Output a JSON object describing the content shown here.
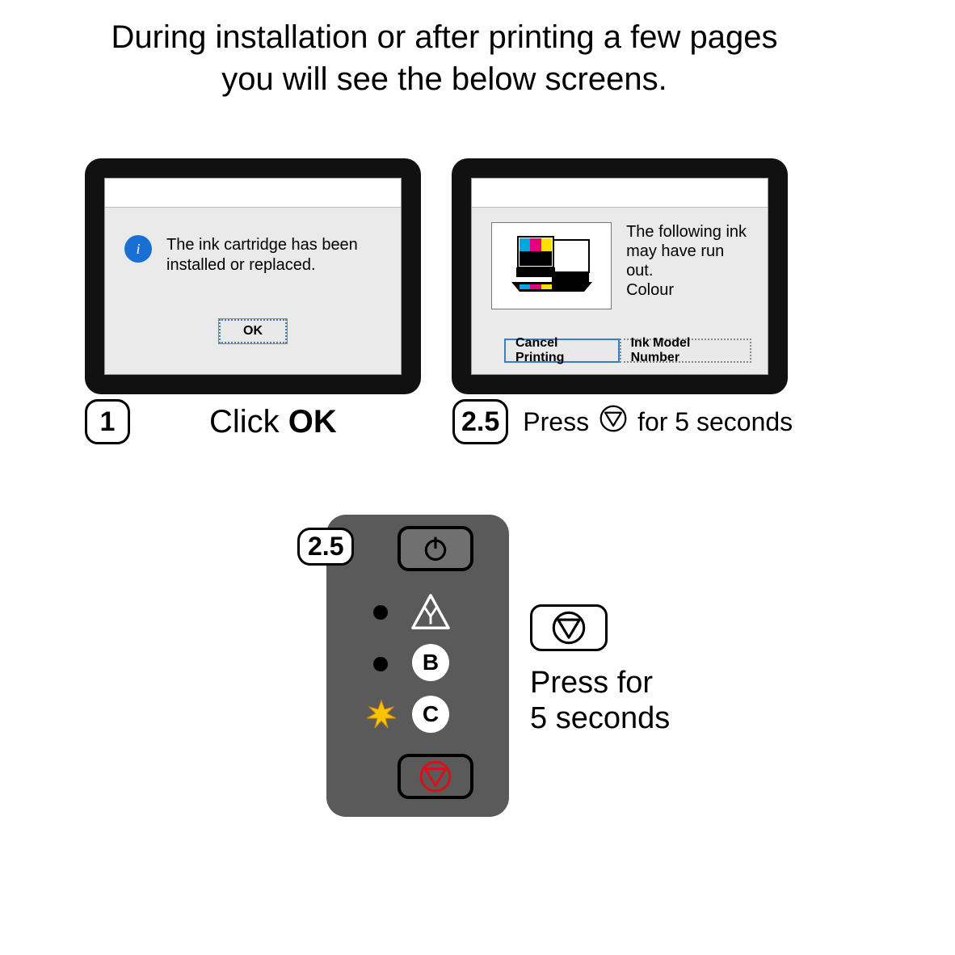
{
  "heading_line1": "During installation or after printing a few pages",
  "heading_line2": "you will see the below screens.",
  "screen1": {
    "message": "The ink cartridge has been installed or replaced.",
    "ok_label": "OK"
  },
  "screen2": {
    "message_line1": "The following ink",
    "message_line2": "may have run out.",
    "message_line3": "Colour",
    "cancel_label": "Cancel Printing",
    "model_label": "Ink Model Number"
  },
  "step1": {
    "number": "1",
    "prefix": "Click ",
    "bold": "OK"
  },
  "step25": {
    "number": "2.5",
    "prefix": "Press",
    "suffix": "for 5 seconds"
  },
  "panel": {
    "badge": "2.5",
    "b_label": "B",
    "c_label": "C",
    "right_line1": "Press for",
    "right_line2": "5 seconds"
  }
}
